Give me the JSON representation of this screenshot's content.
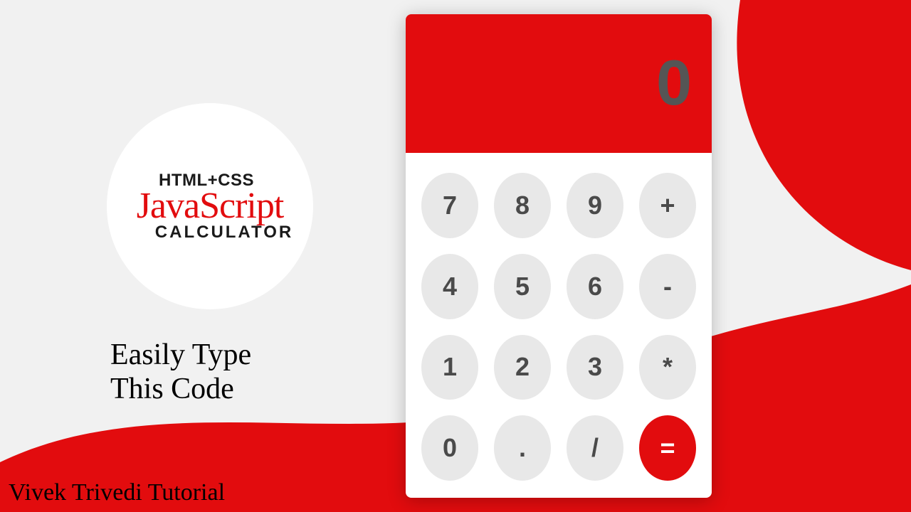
{
  "logo": {
    "top": "HTML+CSS",
    "main": "JavaScript",
    "bottom": "CALCULATOR"
  },
  "tagline": {
    "line1": "Easily Type",
    "line2": "This Code"
  },
  "footer": {
    "credit": "Vivek Trivedi Tutorial"
  },
  "calculator": {
    "display_value": "0",
    "keys": [
      {
        "label": "7",
        "name": "key-7"
      },
      {
        "label": "8",
        "name": "key-8"
      },
      {
        "label": "9",
        "name": "key-9"
      },
      {
        "label": "+",
        "name": "key-plus"
      },
      {
        "label": "4",
        "name": "key-4"
      },
      {
        "label": "5",
        "name": "key-5"
      },
      {
        "label": "6",
        "name": "key-6"
      },
      {
        "label": "-",
        "name": "key-minus"
      },
      {
        "label": "1",
        "name": "key-1"
      },
      {
        "label": "2",
        "name": "key-2"
      },
      {
        "label": "3",
        "name": "key-3"
      },
      {
        "label": "*",
        "name": "key-multiply"
      },
      {
        "label": "0",
        "name": "key-0"
      },
      {
        "label": ".",
        "name": "key-decimal"
      },
      {
        "label": "/",
        "name": "key-divide"
      },
      {
        "label": "=",
        "name": "key-equals",
        "equals": true
      }
    ]
  },
  "colors": {
    "accent": "#e20c0e",
    "bg": "#f1f1f1",
    "key_bg": "#e8e8e8"
  }
}
